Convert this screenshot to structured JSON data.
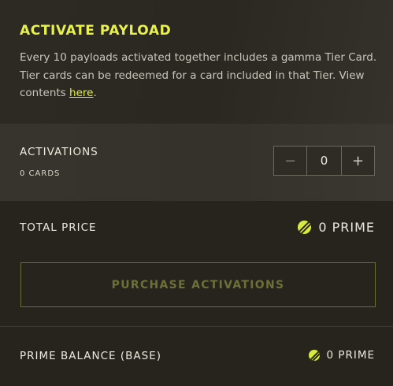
{
  "payload": {
    "title": "ACTIVATE PAYLOAD",
    "description_before": "Every 10 payloads activated together includes a gamma Tier Card. Tier cards can be redeemed for a card included in that Tier. View contents ",
    "link_text": "here",
    "description_after": "."
  },
  "activations": {
    "label": "ACTIVATIONS",
    "cards_count": "0 CARDS",
    "minus": "−",
    "value": "0",
    "plus": "+"
  },
  "price": {
    "label": "TOTAL PRICE",
    "amount": "0 PRIME",
    "icon": "prime-currency-icon"
  },
  "purchase": {
    "label": "PURCHASE ACTIVATIONS"
  },
  "balance": {
    "label": "PRIME BALANCE (BASE)",
    "amount": "0 PRIME",
    "icon": "prime-currency-icon"
  },
  "colors": {
    "accent": "#e8f24a",
    "background": "#26241d",
    "disabled_button": "#6e7038"
  }
}
